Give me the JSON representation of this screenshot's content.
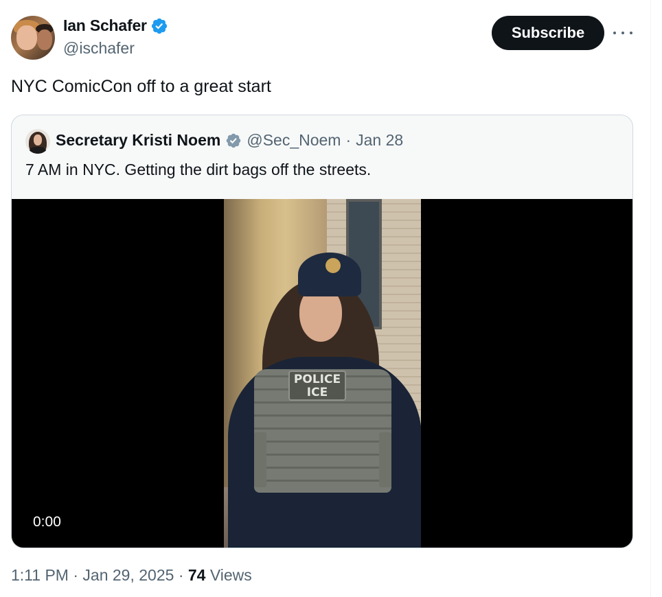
{
  "author": {
    "display_name": "Ian Schafer",
    "handle": "@ischafer",
    "verified_icon": "verified-badge-icon",
    "subscribe_label": "Subscribe",
    "more_icon": "more-horizontal-icon"
  },
  "tweet": {
    "text": "NYC ComicCon off to a great start"
  },
  "quote": {
    "display_name": "Secretary Kristi Noem",
    "handle": "@Sec_Noem",
    "separator": "·",
    "date": "Jan 28",
    "text": "7 AM in NYC. Getting the dirt bags off the streets.",
    "video": {
      "time": "0:00",
      "patch_line1": "POLICE",
      "patch_line2": "ICE"
    }
  },
  "meta": {
    "time": "1:11 PM",
    "sep1": "·",
    "date": "Jan 29, 2025",
    "sep2": "·",
    "views_count": "74",
    "views_label": "Views"
  },
  "colors": {
    "verified": "#1d9bf0",
    "subscribe_bg": "#0f1419",
    "secondary_text": "#536471",
    "quote_border": "#cfd9de",
    "gov_badge": "#829aab"
  }
}
